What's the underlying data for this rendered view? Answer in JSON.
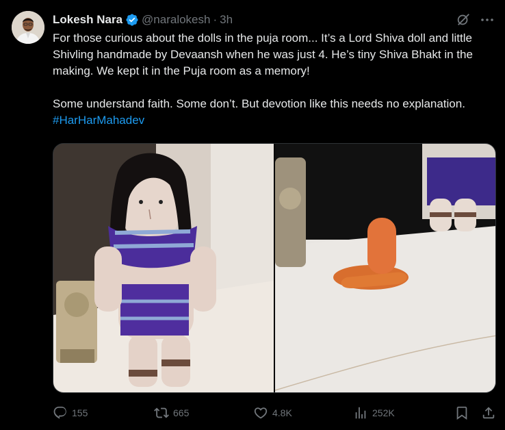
{
  "tweet": {
    "author_name": "Lokesh Nara",
    "handle": "@naralokesh",
    "separator": "·",
    "time": "3h",
    "text_paragraph_1": "For those curious about the dolls in the puja room... It’s a Lord Shiva doll and little Shivling handmade by Devaansh when he was just 4. He’s tiny Shiva Bhakt in the making. We kept it in the Puja room as a memory!",
    "text_paragraph_2": "Some understand faith. Some don’t. But devotion like this needs no explanation.",
    "hashtag": "#HarHarMahadev"
  },
  "media": {
    "images": [
      {
        "icon": "photo-shiva-doll"
      },
      {
        "icon": "photo-shivling"
      }
    ]
  },
  "actions": {
    "replies": "155",
    "reposts": "665",
    "likes": "4.8K",
    "views": "252K"
  },
  "colors": {
    "background": "#000000",
    "text": "#e7e9ea",
    "secondary": "#71767b",
    "link": "#1d9bf0",
    "verified": "#1d9bf0"
  }
}
